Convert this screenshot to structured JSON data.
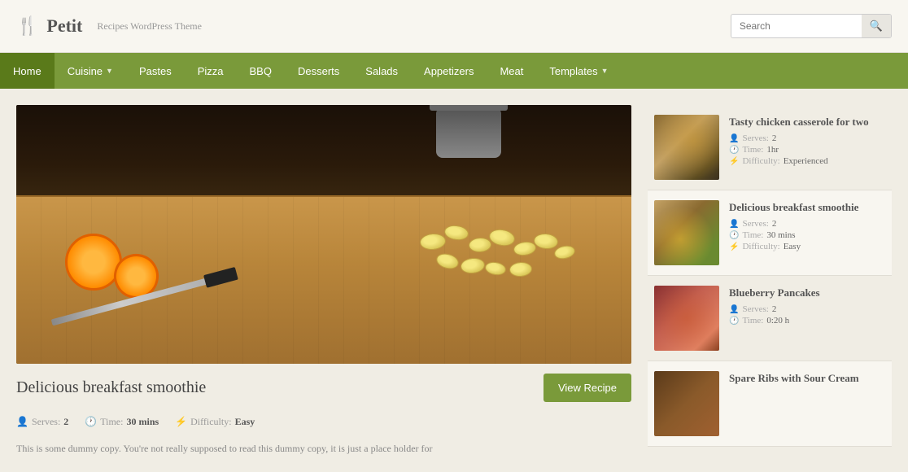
{
  "site": {
    "name": "Petit",
    "tagline": "Recipes WordPress Theme",
    "logo_icon": "🍴"
  },
  "search": {
    "placeholder": "Search",
    "button_label": "🔍"
  },
  "nav": {
    "items": [
      {
        "label": "Home",
        "active": true,
        "has_dropdown": false
      },
      {
        "label": "Cuisine",
        "active": false,
        "has_dropdown": true
      },
      {
        "label": "Pastes",
        "active": false,
        "has_dropdown": false
      },
      {
        "label": "Pizza",
        "active": false,
        "has_dropdown": false
      },
      {
        "label": "BBQ",
        "active": false,
        "has_dropdown": false
      },
      {
        "label": "Desserts",
        "active": false,
        "has_dropdown": false
      },
      {
        "label": "Salads",
        "active": false,
        "has_dropdown": false
      },
      {
        "label": "Appetizers",
        "active": false,
        "has_dropdown": false
      },
      {
        "label": "Meat",
        "active": false,
        "has_dropdown": false
      },
      {
        "label": "Templates",
        "active": false,
        "has_dropdown": true
      }
    ]
  },
  "featured": {
    "title": "Delicious breakfast smoothie",
    "serves_label": "Serves:",
    "serves_value": "2",
    "time_label": "Time:",
    "time_value": "30 mins",
    "difficulty_label": "Difficulty:",
    "difficulty_value": "Easy",
    "view_btn": "View Recipe",
    "description": "This is some dummy copy. You're not really supposed to read this dummy copy, it is just a place holder for"
  },
  "sidebar": {
    "items": [
      {
        "title": "Tasty chicken casserole for two",
        "serves_label": "Serves:",
        "serves_value": "2",
        "time_label": "Time:",
        "time_value": "1hr",
        "difficulty_label": "Difficulty:",
        "difficulty_value": "Experienced"
      },
      {
        "title": "Delicious breakfast smoothie",
        "serves_label": "Serves:",
        "serves_value": "2",
        "time_label": "Time:",
        "time_value": "30 mins",
        "difficulty_label": "Difficulty:",
        "difficulty_value": "Easy"
      },
      {
        "title": "Blueberry Pancakes",
        "serves_label": "Serves:",
        "serves_value": "2",
        "time_label": "Time:",
        "time_value": "0:20 h",
        "difficulty_label": "",
        "difficulty_value": ""
      },
      {
        "title": "Spare Ribs with Sour Cream",
        "serves_label": "",
        "serves_value": "",
        "time_label": "",
        "time_value": "",
        "difficulty_label": "",
        "difficulty_value": ""
      }
    ]
  }
}
